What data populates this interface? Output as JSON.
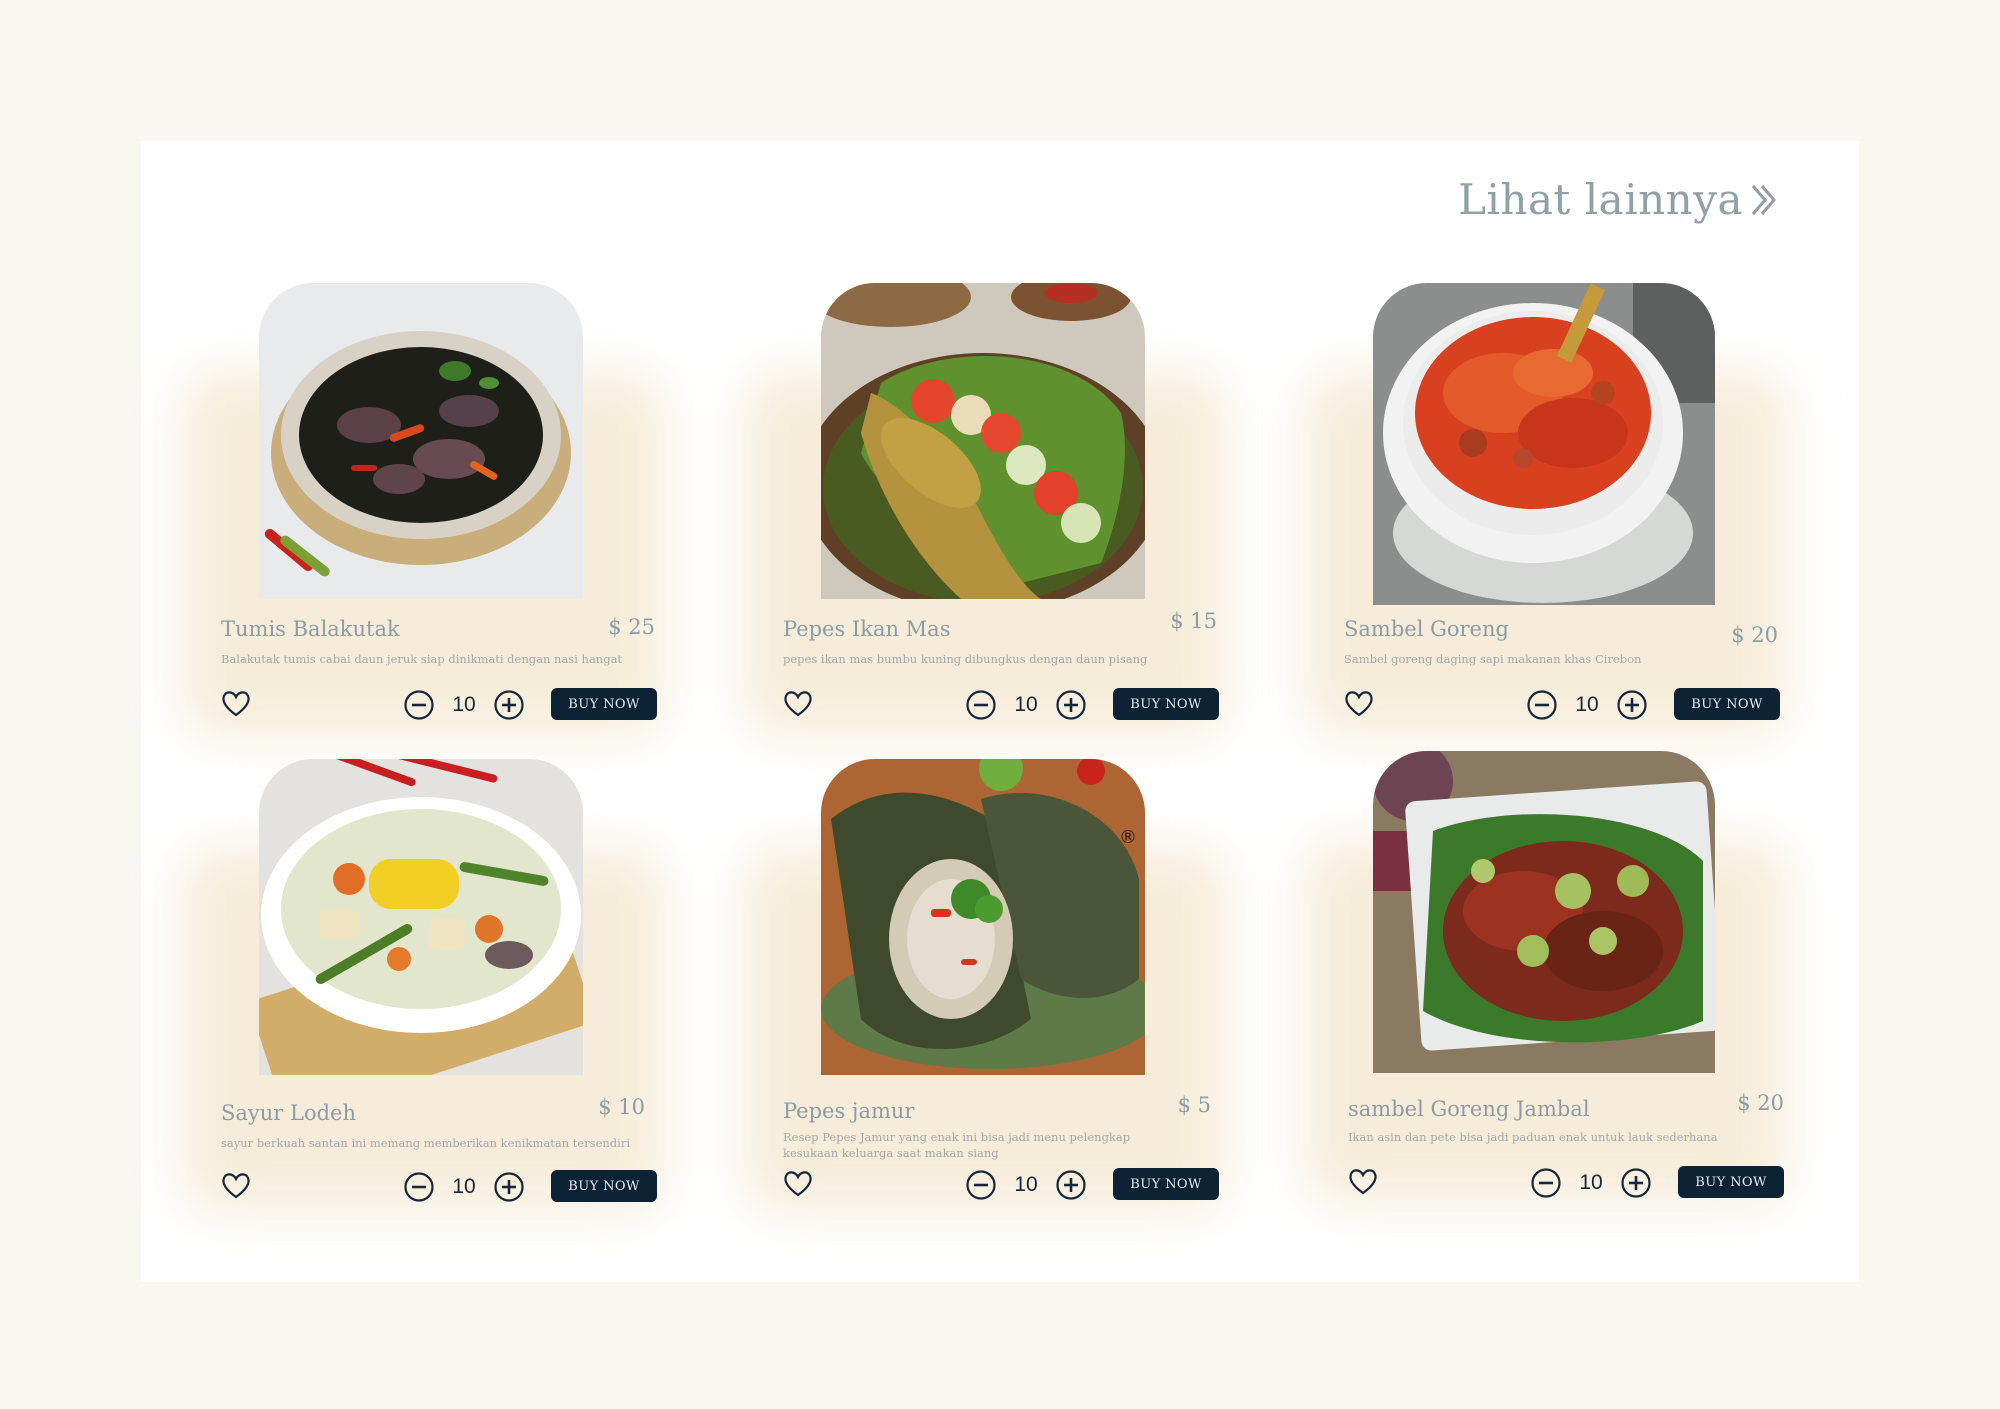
{
  "see_more": {
    "label": "Lihat lainnya",
    "icon": "double-chevron-right-icon"
  },
  "colors": {
    "background": "#f9f7f2",
    "panel": "#ffffff",
    "card_glow": "#f6ecd9",
    "text_muted": "#8b9ca4",
    "button": "#0d2335",
    "button_text": "#e8edf1"
  },
  "products": [
    {
      "name": "Tumis Balakutak",
      "price": "$ 25",
      "description": "Balakutak tumis cabai daun jeruk siap dinikmati dengan nasi hangat",
      "quantity": "10",
      "buy_label": "BUY NOW",
      "favorite_icon": "heart-outline-icon"
    },
    {
      "name": "Pepes Ikan Mas",
      "price": "$ 15",
      "description": "pepes ikan mas bumbu kuning dibungkus dengan daun pisang",
      "quantity": "10",
      "buy_label": "BUY NOW",
      "favorite_icon": "heart-outline-icon"
    },
    {
      "name": "Sambel Goreng",
      "price": "$ 20",
      "description": "Sambel goreng daging sapi makanan khas Cirebon",
      "quantity": "10",
      "buy_label": "BUY NOW",
      "favorite_icon": "heart-outline-icon"
    },
    {
      "name": "Sayur Lodeh",
      "price": "$ 10",
      "description": "sayur berkuah santan ini memang memberikan kenikmatan tersendiri",
      "quantity": "10",
      "buy_label": "BUY NOW",
      "favorite_icon": "heart-outline-icon"
    },
    {
      "name": "Pepes jamur",
      "price": "$ 5",
      "description": "Resep Pepes Jamur yang enak ini bisa jadi menu pelengkap kesukaan keluarga saat makan siang",
      "quantity": "10",
      "buy_label": "BUY NOW",
      "favorite_icon": "heart-outline-icon"
    },
    {
      "name": "sambel Goreng Jambal",
      "price": "$ 20",
      "description": "Ikan asin dan pete bisa jadi paduan enak untuk lauk sederhana",
      "quantity": "10",
      "buy_label": "BUY NOW",
      "favorite_icon": "heart-outline-icon"
    }
  ]
}
